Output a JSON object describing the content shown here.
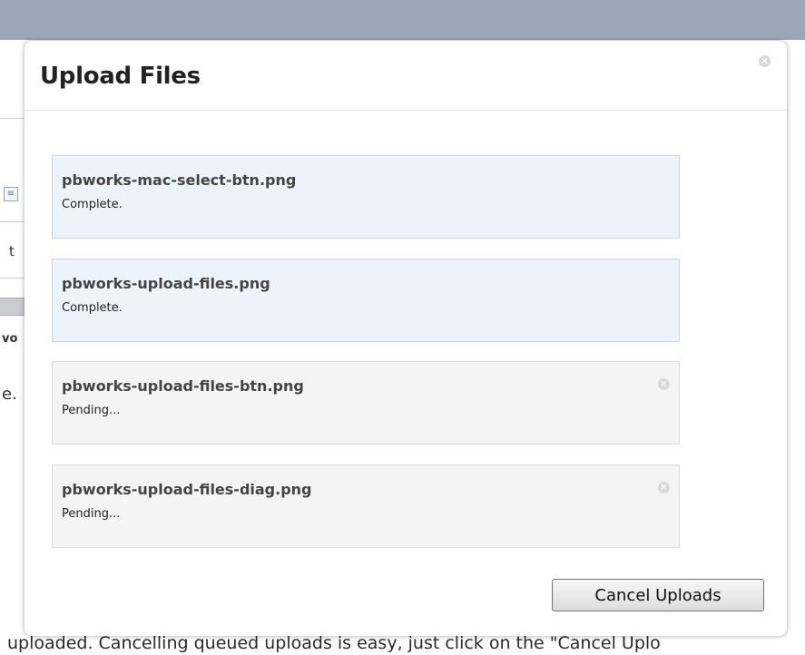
{
  "modal": {
    "title": "Upload Files",
    "close_icon": "close-icon"
  },
  "files": [
    {
      "name": "pbworks-mac-select-btn.png",
      "status": "Complete.",
      "state": "complete"
    },
    {
      "name": "pbworks-upload-files.png",
      "status": "Complete.",
      "state": "complete"
    },
    {
      "name": "pbworks-upload-files-btn.png",
      "status": "Pending...",
      "state": "pending"
    },
    {
      "name": "pbworks-upload-files-diag.png",
      "status": "Pending...",
      "state": "pending"
    }
  ],
  "actions": {
    "cancel_label": "Cancel Uploads"
  },
  "background": {
    "fragment_1": "t",
    "fragment_2": "vo",
    "fragment_3": "e.",
    "bottom_text": "uploaded.  Cancelling queued uploads is easy, just click on the \"Cancel Uplo"
  },
  "colors": {
    "header_bar": "#9ba6b6",
    "complete_bg": "#eef3fb",
    "pending_bg": "#f4f4f4"
  }
}
